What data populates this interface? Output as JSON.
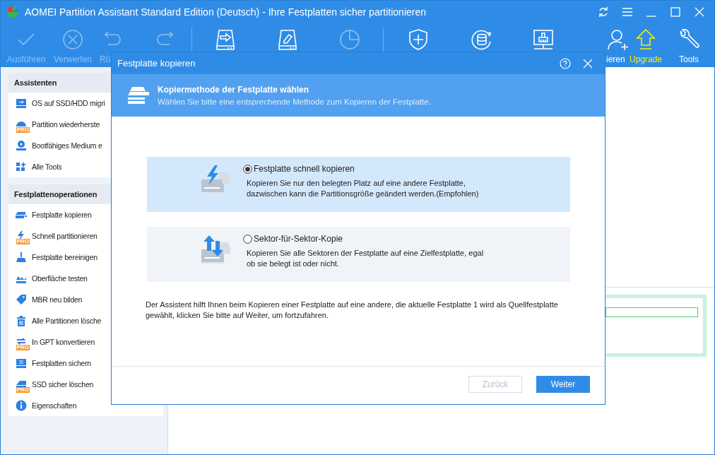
{
  "window": {
    "title": "AOMEI Partition Assistant Standard Edition (Deutsch) - Ihre Festplatten sicher partitionieren"
  },
  "toolbar": {
    "groups": [
      [
        {
          "label": "Ausführen",
          "disabled": true
        },
        {
          "label": "Verwerfen",
          "disabled": true
        },
        {
          "label": "Rü",
          "disabled": true
        },
        {
          "disabled": true
        }
      ],
      [
        {
          "disabled": false
        },
        {
          "disabled": false
        },
        {
          "disabled": true
        }
      ],
      [
        {
          "disabled": false
        },
        {
          "disabled": false
        },
        {
          "disabled": false
        },
        {
          "label": "ieren",
          "disabled": false
        },
        {
          "label": "Upgrade",
          "disabled": false,
          "highlighted": true
        },
        {
          "label": "Tools",
          "disabled": false
        }
      ]
    ]
  },
  "sidebar": {
    "sections": [
      {
        "title": "Assistenten",
        "items": [
          {
            "label": "OS auf SSD/HDD migri"
          },
          {
            "label": "Partition wiederherste",
            "badge": "PRO"
          },
          {
            "label": "Bootfähiges Medium e"
          },
          {
            "label": "Alle Tools"
          }
        ]
      },
      {
        "title": "Festplattenoperationen",
        "items": [
          {
            "label": "Festplatte kopieren"
          },
          {
            "label": "Schnell partitionieren",
            "badge": "PRO"
          },
          {
            "label": "Festplatte bereinigen"
          },
          {
            "label": "Oberfläche testen"
          },
          {
            "label": "MBR neu bilden"
          },
          {
            "label": "Alle Partitionen lösche"
          },
          {
            "label": "In GPT konvertieren",
            "badge": "PRO"
          },
          {
            "label": "Festplatten sichern"
          },
          {
            "label": "SSD sicher löschen",
            "badge": "PRO"
          },
          {
            "label": "Eigenschaften"
          }
        ]
      }
    ]
  },
  "dialog": {
    "title": "Festplatte kopieren",
    "header": {
      "title": "Kopiermethode der Festplatte wählen",
      "subtitle": "Wählen Sie bitte eine entsprechende Methode zum Kopieren der Festplatte."
    },
    "options": [
      {
        "label": "Festplatte schnell kopieren",
        "description": "Kopieren Sie nur den belegten Platz auf eine andere Festplatte, dazwischen kann die Partitionsgröße geändert werden.(Empfohlen)",
        "selected": true
      },
      {
        "label": "Sektor-für-Sektor-Kopie",
        "description": "Kopieren Sie alle Sektoren der Festplatte auf eine Zielfestplatte, egal ob sie belegt ist oder nicht.",
        "selected": false
      }
    ],
    "note": "Der Assistent hilft Ihnen beim Kopieren einer Festplatte auf eine andere, die aktuelle Festplatte 1 wird als Quellfestplatte gewählt, klicken Sie bitte auf Weiter, um fortzufahren.",
    "buttons": [
      {
        "label": "Zurück",
        "disabled": true,
        "primary": false
      },
      {
        "label": "Weiter",
        "disabled": false,
        "primary": true
      }
    ]
  }
}
